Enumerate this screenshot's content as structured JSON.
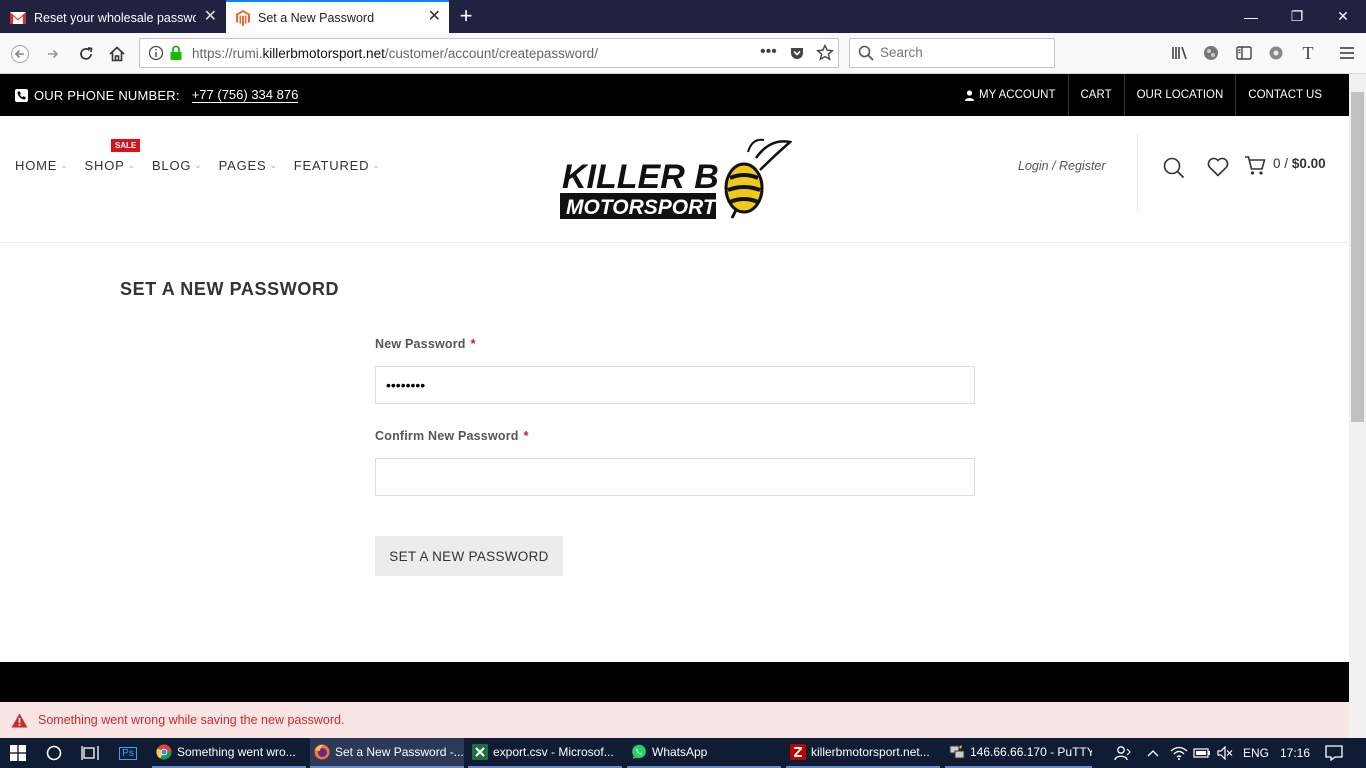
{
  "browser": {
    "tabs": [
      {
        "title": "Reset your wholesale password"
      },
      {
        "title": "Set a New Password"
      }
    ],
    "url": {
      "prefix": "https://rumi.",
      "domain": "killerbmotorsport.net",
      "path": "/customer/account/createpassword/"
    },
    "search_placeholder": "Search"
  },
  "topbar": {
    "phone_label": "OUR PHONE NUMBER:",
    "phone_number": "+77 (756) 334 876",
    "links": [
      "MY ACCOUNT",
      "CART",
      "OUR LOCATION",
      "CONTACT US"
    ]
  },
  "nav": {
    "items": [
      "HOME",
      "SHOP",
      "BLOG",
      "PAGES",
      "FEATURED"
    ],
    "sale_badge": "SALE",
    "login_register": "Login / Register",
    "cart_count": "0",
    "cart_sep": "/",
    "cart_total": "$0.00"
  },
  "logo": {
    "line1": "KILLER B",
    "line2": "MOTORSPORT"
  },
  "form": {
    "title": "SET A NEW PASSWORD",
    "new_password_label": "New Password",
    "new_password_value": "password",
    "confirm_label": "Confirm New Password",
    "confirm_value": "",
    "required_mark": "*",
    "submit_label": "SET A NEW PASSWORD"
  },
  "error": {
    "message": "Something went wrong while saving the new password."
  },
  "taskbar": {
    "apps": [
      {
        "label": "Something went wro..."
      },
      {
        "label": "Set a New Password -..."
      },
      {
        "label": "export.csv - Microsof..."
      },
      {
        "label": "WhatsApp"
      },
      {
        "label": "killerbmotorsport.net..."
      },
      {
        "label": "146.66.66.170 - PuTTY"
      }
    ],
    "ps_label": "Ps",
    "language": "ENG",
    "time": "17:16"
  },
  "colors": {
    "accent_red": "#d6141e",
    "error_bg": "#fae5e5",
    "error_text": "#c72c2c",
    "tabbar": "#202340"
  }
}
